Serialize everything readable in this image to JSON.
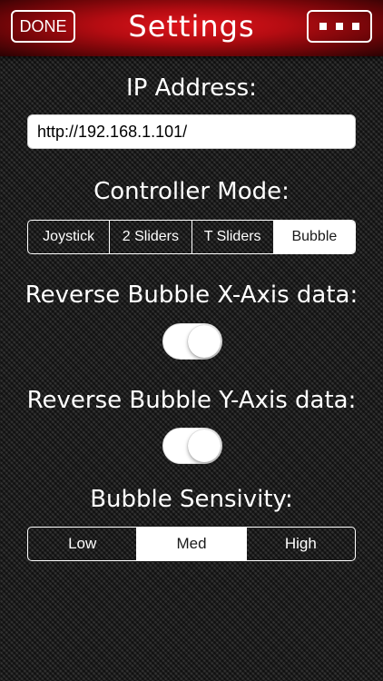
{
  "header": {
    "title": "Settings",
    "done_label": "DONE",
    "more_icon": "ellipsis-icon"
  },
  "ip": {
    "label": "IP Address:",
    "value": "http://192.168.1.101/"
  },
  "controller_mode": {
    "label": "Controller Mode:",
    "options": [
      "Joystick",
      "2 Sliders",
      "T Sliders",
      "Bubble"
    ],
    "selected": "Bubble"
  },
  "reverse_x": {
    "label": "Reverse Bubble X-Axis data:",
    "on": false
  },
  "reverse_y": {
    "label": "Reverse Bubble Y-Axis data:",
    "on": false
  },
  "sensitivity": {
    "label": "Bubble Sensivity:",
    "options": [
      "Low",
      "Med",
      "High"
    ],
    "selected": "Med"
  },
  "colors": {
    "header_red": "#c00d13",
    "background": "#232323",
    "foreground": "#ffffff"
  }
}
